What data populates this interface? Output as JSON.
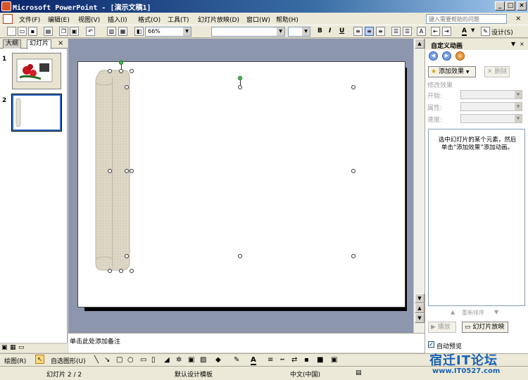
{
  "window": {
    "title": "Microsoft PowerPoint - [演示文稿1]"
  },
  "menu": {
    "items": [
      "文件(F)",
      "编辑(E)",
      "视图(V)",
      "插入(I)",
      "格式(O)",
      "工具(T)",
      "幻灯片放映(D)",
      "窗口(W)",
      "帮助(H)"
    ],
    "help_placeholder": "键入需要帮助的问题"
  },
  "toolbar": {
    "zoom": "66%",
    "design_label": "设计(S)"
  },
  "left_panel": {
    "tabs": [
      "大纲",
      "幻灯片"
    ],
    "slides": [
      {
        "num": "1"
      },
      {
        "num": "2"
      }
    ]
  },
  "notes": {
    "placeholder": "单击此处添加备注"
  },
  "task_pane": {
    "title": "自定义动画",
    "add_effect": "添加效果",
    "remove": "删除",
    "modify_label": "修改效果",
    "start_label": "开始:",
    "property_label": "属性:",
    "speed_label": "速度:",
    "hint": "选中幻灯片的某个元素，然后单击“添加效果”添加动画。",
    "reorder": "重新排序",
    "play": "播放",
    "slideshow": "幻灯片放映",
    "autopreview": "自动预览"
  },
  "draw_toolbar": {
    "draw_label": "绘图(R)",
    "autoshapes_label": "自选图形(U)"
  },
  "status": {
    "slide": "幻灯片 2 / 2",
    "design": "默认设计模板",
    "language": "中文(中国)"
  },
  "watermark": {
    "cn": "宿迁IT论坛",
    "url": "www.IT0527.com"
  },
  "colors": {
    "title_bar": "#0a246a",
    "canvas_bg": "#8c96ad",
    "scroll_shape": "#ddd6c5"
  }
}
